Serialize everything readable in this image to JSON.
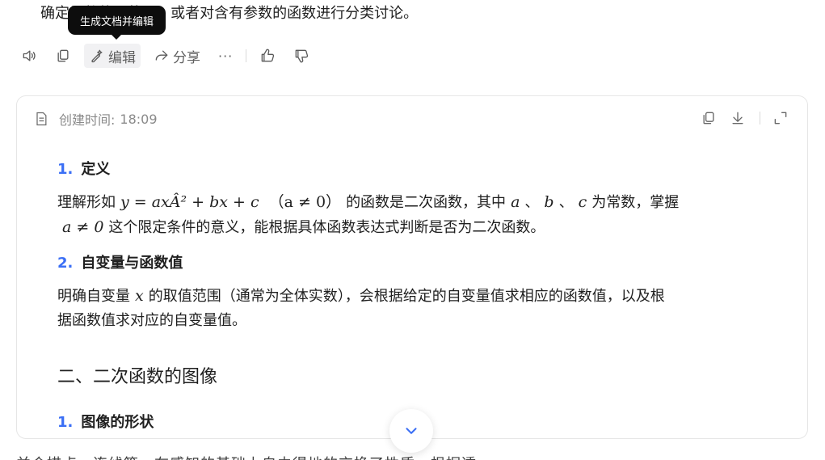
{
  "top_text": "确定函数的...范围，或者对含有参数的函数进行分类讨论。",
  "tooltip": "生成文档并编辑",
  "actions": {
    "edit_label": "编辑",
    "share_label": "分享",
    "more_label": "···"
  },
  "doc": {
    "created_label": "创建时间:",
    "created_time": "18:09",
    "sections": [
      {
        "num": "1.",
        "title": "定义"
      },
      {
        "num": "2.",
        "title": "自变量与函数值"
      }
    ],
    "para1": {
      "a": "理解形如",
      "formula": "y = axÂ² + bx + c",
      "cond": "（a ≠ 0）",
      "b": "的函数是二次函数，其中",
      "v1": "a",
      "sep1": "、",
      "v2": "b",
      "sep2": "、",
      "v3": "c",
      "c": "为常数，掌握",
      "cond2": "a ≠ 0",
      "d": "这个限定条件的意义，能根据具体函数表达式判断是否为二次函数。"
    },
    "para2": {
      "a": "明确自变量",
      "var": "x",
      "b": "的取值范围（通常为全体实数），会根据给定的自变量值求相应的函数值，以及根",
      "c": "据函数值求对应的自变量值。"
    },
    "h2": "二、二次函数的图像",
    "sub1": {
      "num": "1.",
      "title": "图像的形状"
    }
  },
  "bottom_text": "并会描点、连线等。在感知的基础上自由得地的交换了性质。根据透"
}
